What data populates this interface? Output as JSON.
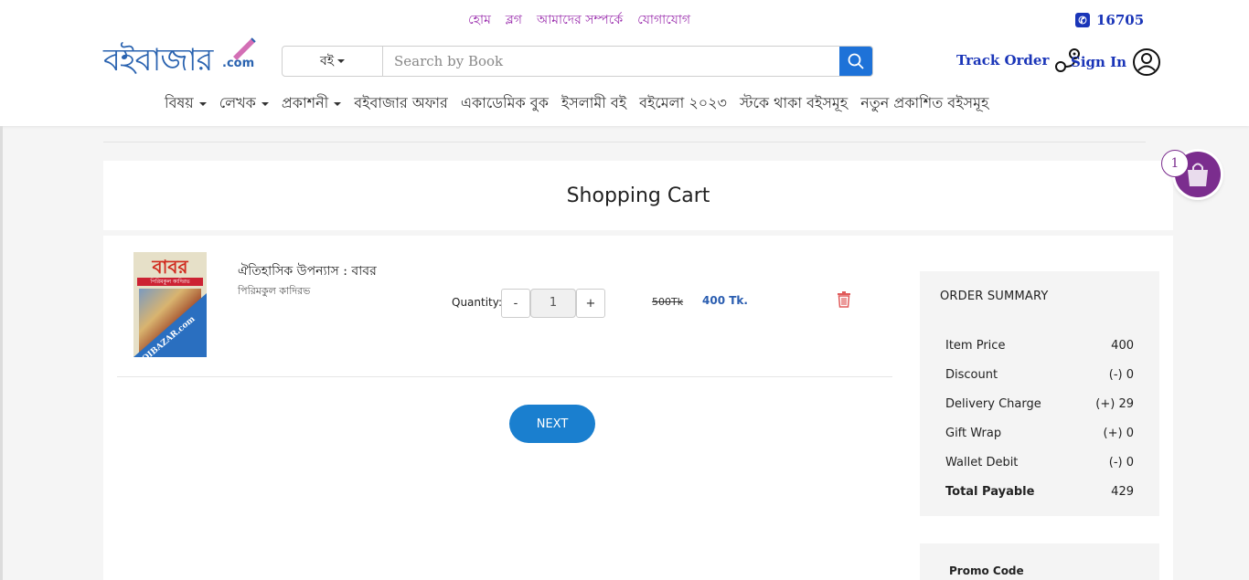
{
  "topbar": {
    "links": [
      "হোম",
      "ব্লগ",
      "আমাদের সম্পর্কে",
      "যোগাযোগ"
    ],
    "phone": "16705"
  },
  "logo": {
    "text": "বইবাজার",
    "suffix": ".com"
  },
  "search": {
    "category": "বই",
    "placeholder": "Search by Book"
  },
  "account": {
    "track_order": "Track Order",
    "sign_in": "Sign In"
  },
  "nav": [
    {
      "label": "বিষয়",
      "dropdown": true
    },
    {
      "label": "লেখক",
      "dropdown": true
    },
    {
      "label": "প্রকাশনী",
      "dropdown": true
    },
    {
      "label": "বইবাজার অফার",
      "dropdown": false
    },
    {
      "label": "একাডেমিক বুক",
      "dropdown": false
    },
    {
      "label": "ইসলামী বই",
      "dropdown": false
    },
    {
      "label": "বইমেলা ২০২৩",
      "dropdown": false
    },
    {
      "label": "স্টকে থাকা বইসমূহ",
      "dropdown": false
    },
    {
      "label": "নতুন প্রকাশিত বইসমূহ",
      "dropdown": false
    }
  ],
  "page": {
    "title": "Shopping Cart"
  },
  "cart_item": {
    "cover_title": "বাবর",
    "cover_author": "পিরিমকুল কাদিরভ",
    "cover_brand": "BOIBAZAR.com",
    "name": "ঐতিহাসিক উপন্যাস  : বাবর",
    "author": "পিরিমকুল কাদিরভ",
    "quantity_label": "Quantity:",
    "quantity": "1",
    "minus": "-",
    "plus": "+",
    "old_price": "500Tk",
    "price": "400 Tk."
  },
  "next_label": "NEXT",
  "summary": {
    "title": "ORDER SUMMARY",
    "rows": [
      {
        "label": "Item Price",
        "value": "400"
      },
      {
        "label": "Discount",
        "value": "(-) 0"
      },
      {
        "label": "Delivery Charge",
        "value": "(+) 29"
      },
      {
        "label": "Gift Wrap",
        "value": "(+) 0"
      },
      {
        "label": "Wallet Debit",
        "value": "(-) 0"
      },
      {
        "label": "Total Payable",
        "value": "429"
      }
    ]
  },
  "promo": {
    "label": "Promo Code"
  },
  "floating_cart": {
    "count": "1"
  },
  "colors": {
    "brand_blue": "#1a35b8",
    "toplink_purple": "#9b2fae",
    "search_button": "#1e72d8",
    "next_button": "#1a7fcf",
    "cart_purple": "#7b2d8e",
    "delete_red": "#e05a5a"
  }
}
